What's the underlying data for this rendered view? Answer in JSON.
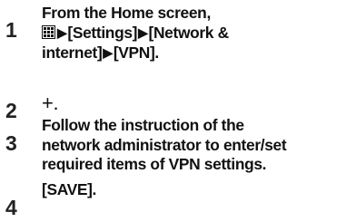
{
  "steps": [
    {
      "number": "1",
      "line1": "From the Home screen,",
      "icon": "apps-grid-icon",
      "arrow": "▶",
      "settings": "[Settings]",
      "network": "[Network &",
      "internet": "internet]",
      "vpn": "[VPN]."
    },
    {
      "number": "2",
      "icon": "plus-icon",
      "plus": "+",
      "text": "."
    },
    {
      "number": "3",
      "line1": "Follow the instruction of the",
      "line2": "network administrator to enter/set",
      "line3": "required items of VPN settings."
    },
    {
      "number": "4",
      "text": "[SAVE]."
    }
  ]
}
